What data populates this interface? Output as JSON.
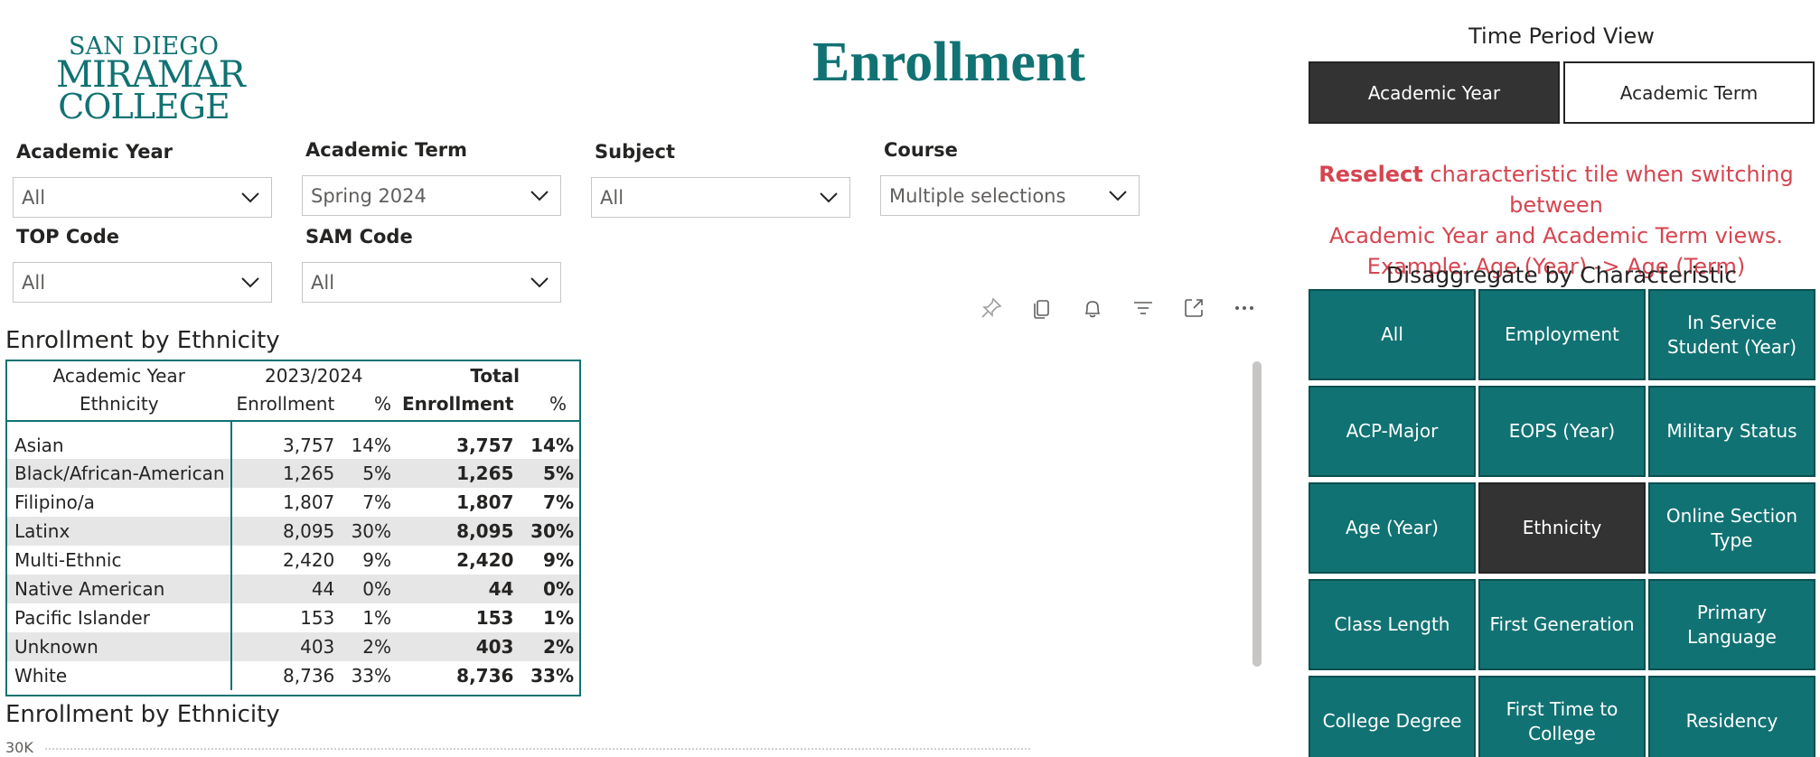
{
  "logo": {
    "line1": "SAN DIEGO",
    "line2": "MIRAMAR",
    "line3": "COLLEGE"
  },
  "page_title": "Enrollment",
  "filters": [
    {
      "label": "Academic Year",
      "value": "All"
    },
    {
      "label": "Academic Term",
      "value": "Spring 2024"
    },
    {
      "label": "Subject",
      "value": "All"
    },
    {
      "label": "Course",
      "value": "Multiple selections"
    },
    {
      "label": "TOP Code",
      "value": "All"
    },
    {
      "label": "SAM Code",
      "value": "All"
    }
  ],
  "visual_header_icons": [
    "pin-icon",
    "copy-icon",
    "bell-icon",
    "filter-icon",
    "focus-mode-icon",
    "more-options-icon"
  ],
  "table": {
    "title": "Enrollment by Ethnicity",
    "header_row1": {
      "col0": "Academic Year",
      "col1": "2023/2024",
      "col3": "Total"
    },
    "header_row2": {
      "col0": "Ethnicity",
      "col1": "Enrollment",
      "col2": "%",
      "col3": "Enrollment",
      "col4": "%"
    },
    "rows": [
      {
        "ethnicity": "Asian",
        "enrollment": "3,757",
        "pct": "14%",
        "total_enrollment": "3,757",
        "total_pct": "14%"
      },
      {
        "ethnicity": "Black/African-American",
        "enrollment": "1,265",
        "pct": "5%",
        "total_enrollment": "1,265",
        "total_pct": "5%"
      },
      {
        "ethnicity": "Filipino/a",
        "enrollment": "1,807",
        "pct": "7%",
        "total_enrollment": "1,807",
        "total_pct": "7%"
      },
      {
        "ethnicity": "Latinx",
        "enrollment": "8,095",
        "pct": "30%",
        "total_enrollment": "8,095",
        "total_pct": "30%"
      },
      {
        "ethnicity": "Multi-Ethnic",
        "enrollment": "2,420",
        "pct": "9%",
        "total_enrollment": "2,420",
        "total_pct": "9%"
      },
      {
        "ethnicity": "Native American",
        "enrollment": "44",
        "pct": "0%",
        "total_enrollment": "44",
        "total_pct": "0%"
      },
      {
        "ethnicity": "Pacific Islander",
        "enrollment": "153",
        "pct": "1%",
        "total_enrollment": "153",
        "total_pct": "1%"
      },
      {
        "ethnicity": "Unknown",
        "enrollment": "403",
        "pct": "2%",
        "total_enrollment": "403",
        "total_pct": "2%"
      },
      {
        "ethnicity": "White",
        "enrollment": "8,736",
        "pct": "33%",
        "total_enrollment": "8,736",
        "total_pct": "33%"
      }
    ]
  },
  "chart": {
    "title": "Enrollment by Ethnicity",
    "y_tick_top": "30K"
  },
  "time_period_view": {
    "title": "Time Period View",
    "buttons": [
      {
        "label": "Academic Year",
        "active": true
      },
      {
        "label": "Academic Term",
        "active": false
      }
    ]
  },
  "notice": {
    "bold": "Reselect",
    "text1": " characteristic tile when switching between",
    "text2": "Academic Year and Academic Term views.",
    "text3": "Example: Age (Year) -> Age (Term)"
  },
  "disaggregate": {
    "title": "Disaggregate by Characteristic",
    "tiles": [
      {
        "label": "All",
        "selected": false
      },
      {
        "label": "Employment",
        "selected": false
      },
      {
        "label": "In Service\nStudent (Year)",
        "selected": false
      },
      {
        "label": "ACP-Major",
        "selected": false
      },
      {
        "label": "EOPS (Year)",
        "selected": false
      },
      {
        "label": "Military Status",
        "selected": false
      },
      {
        "label": "Age (Year)",
        "selected": false
      },
      {
        "label": "Ethnicity",
        "selected": true
      },
      {
        "label": "Online Section\nType",
        "selected": false
      },
      {
        "label": "Class Length",
        "selected": false
      },
      {
        "label": "First Generation",
        "selected": false
      },
      {
        "label": "Primary\nLanguage",
        "selected": false
      },
      {
        "label": "College Degree",
        "selected": false
      },
      {
        "label": "First Time to\nCollege",
        "selected": false
      },
      {
        "label": "Residency",
        "selected": false
      }
    ]
  },
  "colors": {
    "accent": "#117273",
    "selected_tile": "#333333",
    "notice": "#d64550"
  }
}
